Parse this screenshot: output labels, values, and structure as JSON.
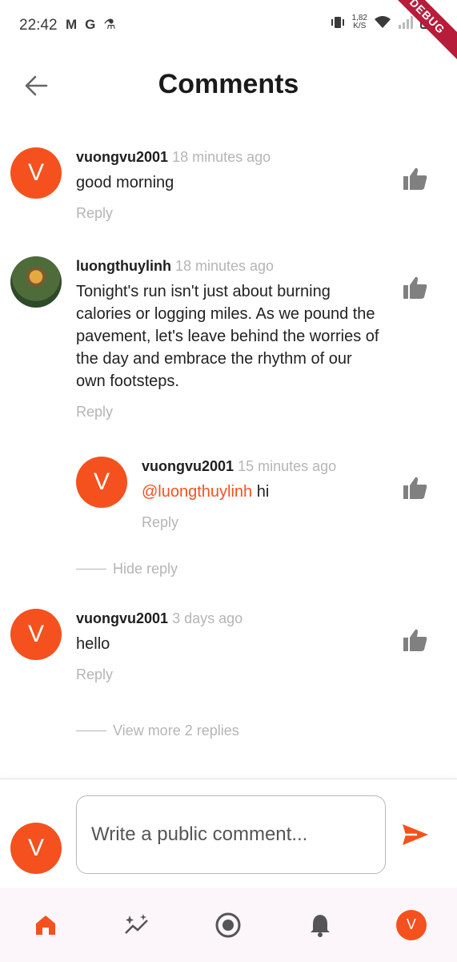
{
  "status_bar": {
    "time": "22:42",
    "left_icons": [
      "M",
      "G",
      "⚗"
    ],
    "net_speed_top": "1,82",
    "net_speed_bottom": "K/S",
    "debug": "DEBUG"
  },
  "header": {
    "title": "Comments"
  },
  "comments": [
    {
      "username": "vuongvu2001",
      "time": "18 minutes ago",
      "text": "good morning",
      "reply": "Reply",
      "avatar_letter": "V"
    },
    {
      "username": "luongthuylinh",
      "time": "18 minutes ago",
      "text": "Tonight's run isn't just about burning calories or logging miles. As we pound the pavement, let's leave behind the worries of the day and embrace the rhythm of our own footsteps.",
      "reply": "Reply"
    },
    {
      "username": "vuongvu2001",
      "time": "15 minutes ago",
      "mention": "@luongthuylinh",
      "text": " hi",
      "reply": "Reply",
      "avatar_letter": "V"
    },
    {
      "username": "vuongvu2001",
      "time": "3 days ago",
      "text": "hello",
      "reply": "Reply",
      "avatar_letter": "V"
    }
  ],
  "hide_reply": "Hide reply",
  "view_more": "View more 2 replies",
  "composer": {
    "placeholder": "Write a public comment...",
    "avatar_letter": "V"
  },
  "nav": {
    "profile_letter": "V"
  },
  "colors": {
    "accent": "#f4511e",
    "muted": "#b5b5b5"
  }
}
